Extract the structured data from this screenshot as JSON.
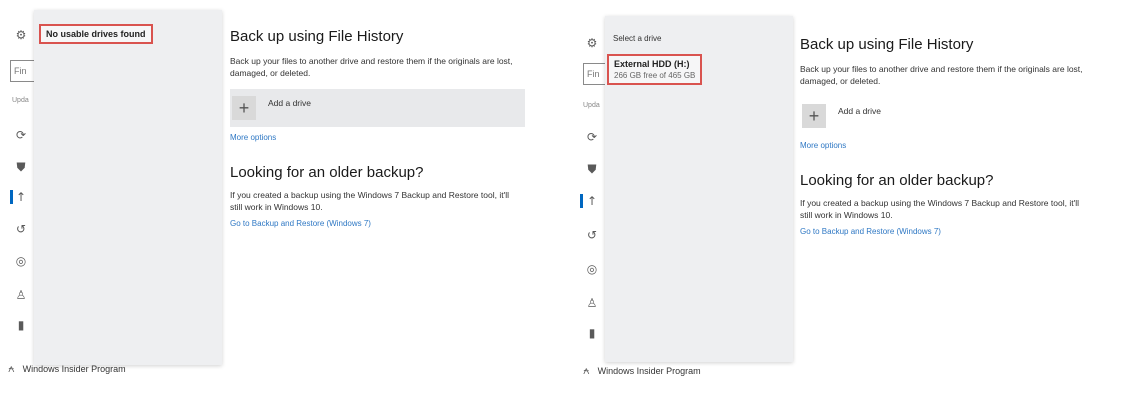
{
  "left": {
    "flyout": {
      "message": "No usable drives found"
    },
    "search": {
      "value": "Fin"
    },
    "rail_heading": "Upda",
    "insider_label": "Windows Insider Program",
    "content": {
      "title": "Back up using File History",
      "description": "Back up your files to another drive and restore them if the originals are lost, damaged, or deleted.",
      "add_drive": "Add a drive",
      "more_options": "More options",
      "older_title": "Looking for an older backup?",
      "older_desc": "If you created a backup using the Windows 7 Backup and Restore tool, it'll still work in Windows 10.",
      "older_link": "Go to Backup and Restore (Windows 7)"
    }
  },
  "right": {
    "flyout": {
      "heading": "Select a drive",
      "drive_name": "External HDD (H:)",
      "drive_space": "266 GB free of 465 GB"
    },
    "search": {
      "value": "Fin"
    },
    "rail_heading": "Upda",
    "insider_label": "Windows Insider Program",
    "content": {
      "title": "Back up using File History",
      "description": "Back up your files to another drive and restore them if the originals are lost, damaged, or deleted.",
      "add_drive": "Add a drive",
      "more_options": "More options",
      "older_title": "Looking for an older backup?",
      "older_desc": "If you created a backup using the Windows 7 Backup and Restore tool, it'll still work in Windows 10.",
      "older_link": "Go to Backup and Restore (Windows 7)"
    }
  },
  "icons": {
    "rail": [
      "gear-icon",
      "sync-icon",
      "shield-icon",
      "backup-icon",
      "history-icon",
      "target-icon",
      "person-icon",
      "lock-icon"
    ],
    "plus": "plus-icon",
    "insider": "insider-icon"
  },
  "colors": {
    "accent": "#0067c0",
    "highlight_border": "#d9534f",
    "link": "#2f78c4",
    "flyout_bg": "#eeeff1"
  }
}
